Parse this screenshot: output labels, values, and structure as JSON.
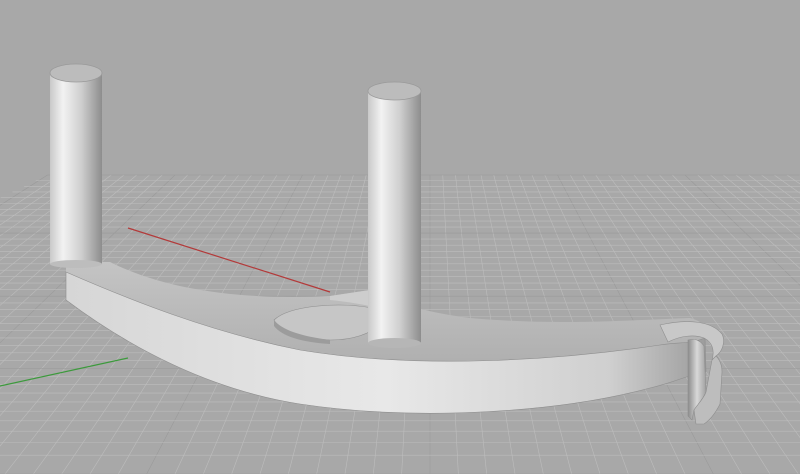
{
  "viewport": {
    "background_color": "#a8a8a8",
    "grid_line_color": "#bdbdbd",
    "grid_major_color": "#9a9a9a",
    "x_axis_color": "#b33a3a",
    "y_axis_color": "#3c9a3c",
    "model_color": "#d4d4d4",
    "model_shadow_color": "#9a9a9a"
  },
  "model": {
    "objects": [
      "curved-bracket",
      "left-post",
      "right-post",
      "hook-end"
    ]
  }
}
